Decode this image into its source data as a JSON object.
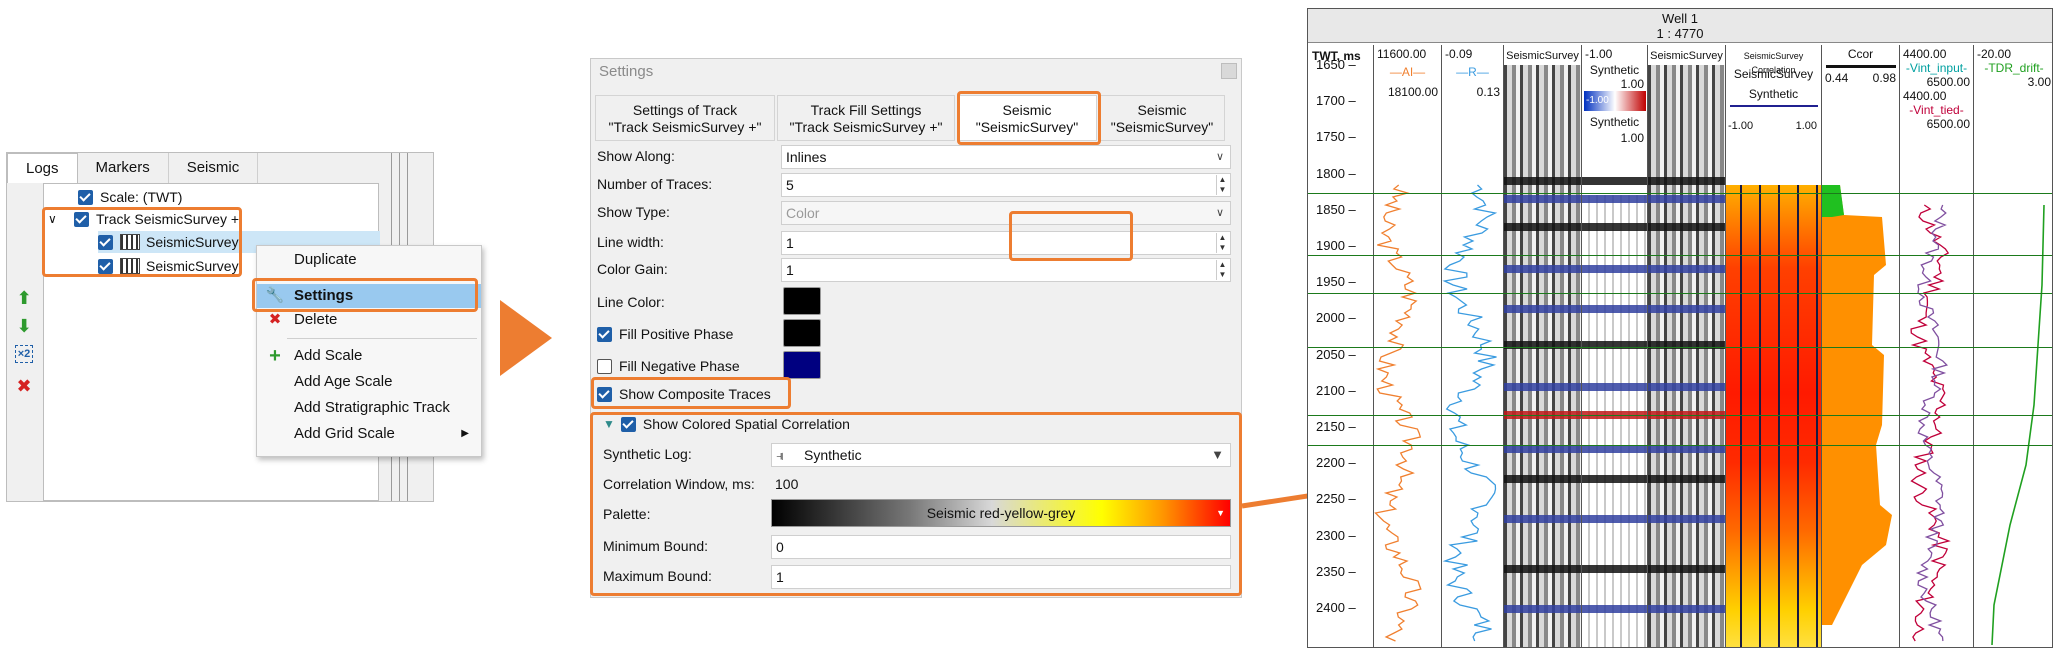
{
  "log_panel": {
    "tabs": [
      "Logs",
      "Markers",
      "Seismic"
    ],
    "tree": {
      "scale_item": "Scale: (TWT)",
      "track_item": "Track SeismicSurvey +",
      "child_items": [
        "SeismicSurvey",
        "SeismicSurvey"
      ]
    },
    "side_icons": [
      "arrow-up-icon",
      "arrow-down-icon",
      "scale-x2-icon",
      "delete-icon"
    ]
  },
  "context_menu": {
    "items": [
      "Duplicate",
      "Settings",
      "Delete",
      "Add Scale",
      "Add Age Scale",
      "Add Stratigraphic Track",
      "Add Grid Scale"
    ],
    "highlighted": "Settings",
    "colors": {
      "highlight": "#99c9ef",
      "annotation": "#ed7d31"
    }
  },
  "settings_dialog": {
    "title": "Settings",
    "tabs": [
      {
        "line1": "Settings of Track",
        "line2": "\"Track SeismicSurvey +\""
      },
      {
        "line1": "Track Fill Settings",
        "line2": "\"Track SeismicSurvey +\""
      },
      {
        "line1": "Seismic",
        "line2": "\"SeismicSurvey\""
      },
      {
        "line1": "Seismic",
        "line2": "\"SeismicSurvey\""
      }
    ],
    "active_tab_index": 2,
    "fields": {
      "show_along": {
        "label": "Show Along:",
        "value": "Inlines"
      },
      "number_of_traces": {
        "label": "Number of Traces:",
        "value": "5"
      },
      "show_type": {
        "label": "Show Type:",
        "value": "Color"
      },
      "line_width": {
        "label": "Line width:",
        "value": "1"
      },
      "color_gain": {
        "label": "Color Gain:",
        "value": "1"
      },
      "line_color": {
        "label": "Line Color:",
        "color": "#000000"
      },
      "fill_positive": {
        "label": "Fill Positive Phase",
        "checked": true,
        "color": "#000000"
      },
      "fill_negative": {
        "label": "Fill Negative Phase",
        "checked": false,
        "color": "#000080"
      },
      "show_composite": {
        "label": "Show Composite Traces",
        "checked": true
      }
    },
    "correlation": {
      "header": "Show Colored Spatial Correlation",
      "synthetic_log": {
        "label": "Synthetic Log:",
        "value": "Synthetic"
      },
      "window": {
        "label": "Correlation Window, ms:",
        "value": "100"
      },
      "palette": {
        "label": "Palette:",
        "value": "Seismic red-yellow-grey"
      },
      "min_bound": {
        "label": "Minimum Bound:",
        "value": "0"
      },
      "max_bound": {
        "label": "Maximum Bound:",
        "value": "1"
      }
    }
  },
  "well_panel": {
    "title": "Well 1",
    "scale": "1 : 4770",
    "depth_header": "TWT, ms",
    "depth_ticks": [
      "1650",
      "1700",
      "1750",
      "1800",
      "1850",
      "1900",
      "1950",
      "2000",
      "2050",
      "2100",
      "2150",
      "2200",
      "2250",
      "2300",
      "2350",
      "2400"
    ],
    "tracks": {
      "ai": {
        "min": "11600.00",
        "name": "AI",
        "max": "18100.00"
      },
      "r": {
        "min": "-0.09",
        "name": "R",
        "max": "0.13"
      },
      "seismic1": {
        "name": "SeismicSurvey"
      },
      "synthetic": {
        "top": "-1.00",
        "name1": "Synthetic",
        "one": "1.00",
        "neg": "-1.00",
        "name2": "Synthetic",
        "one2": "1.00"
      },
      "seismic2": {
        "name": "SeismicSurvey"
      },
      "correlation": {
        "title": "SeismicSurvey Correlation",
        "name1": "SeismicSurvey",
        "name2": "Synthetic",
        "min": "-1.00",
        "max": "1.00"
      },
      "ccor": {
        "name": "Ccor",
        "min": "0.44",
        "max": "0.98"
      },
      "vint": {
        "min": "4400.00",
        "name1": "Vint_input",
        "max": "6500.00",
        "min2": "4400.00",
        "name2": "Vint_tied",
        "max2": "6500.00"
      },
      "tdr": {
        "min": "-20.00",
        "name": "TDR_drift",
        "max": "3.00"
      }
    }
  }
}
